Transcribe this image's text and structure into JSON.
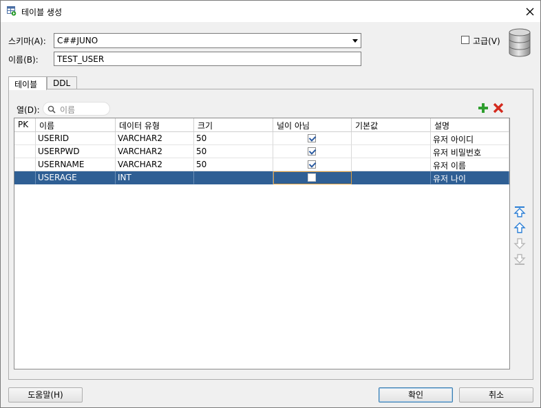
{
  "window": {
    "title": "테이블 생성",
    "close_glyph": "✕"
  },
  "form": {
    "schema_label": "스키마(A):",
    "schema_value": "C##JUNO",
    "name_label": "이름(B):",
    "name_value": "TEST_USER",
    "advanced_label": "고급(V)",
    "advanced_checked": false
  },
  "tabs": [
    {
      "label": "테이블",
      "active": true
    },
    {
      "label": "DDL",
      "active": false
    }
  ],
  "columns_bar": {
    "label": "열(D):",
    "search_placeholder": "이름"
  },
  "grid": {
    "headers": [
      "PK",
      "이름",
      "데이터 유형",
      "크기",
      "널이 아님",
      "기본값",
      "설명"
    ],
    "rows": [
      {
        "pk": "",
        "name": "USERID",
        "type": "VARCHAR2",
        "size": "50",
        "not_null": true,
        "default": "",
        "comment": "유저 아이디",
        "selected": false
      },
      {
        "pk": "",
        "name": "USERPWD",
        "type": "VARCHAR2",
        "size": "50",
        "not_null": true,
        "default": "",
        "comment": "유저 비밀번호",
        "selected": false
      },
      {
        "pk": "",
        "name": "USERNAME",
        "type": "VARCHAR2",
        "size": "50",
        "not_null": true,
        "default": "",
        "comment": "유저 이름",
        "selected": false
      },
      {
        "pk": "",
        "name": "USERAGE",
        "type": "INT",
        "size": "",
        "not_null": false,
        "default": "",
        "comment": "유저 나이",
        "selected": true
      }
    ]
  },
  "buttons": {
    "help": "도움말(H)",
    "ok": "확인",
    "cancel": "취소"
  },
  "icons": {
    "add": "add-column-icon",
    "remove": "remove-column-icon",
    "move_top": "move-top-icon",
    "move_up": "move-up-icon",
    "move_down": "move-down-icon",
    "move_bottom": "move-bottom-icon"
  },
  "colors": {
    "selection": "#2f5f94",
    "add": "#2e9e2e",
    "remove": "#d42a1e",
    "arrow_active": "#2b7fd6",
    "arrow_disabled": "#b8b8b8"
  }
}
